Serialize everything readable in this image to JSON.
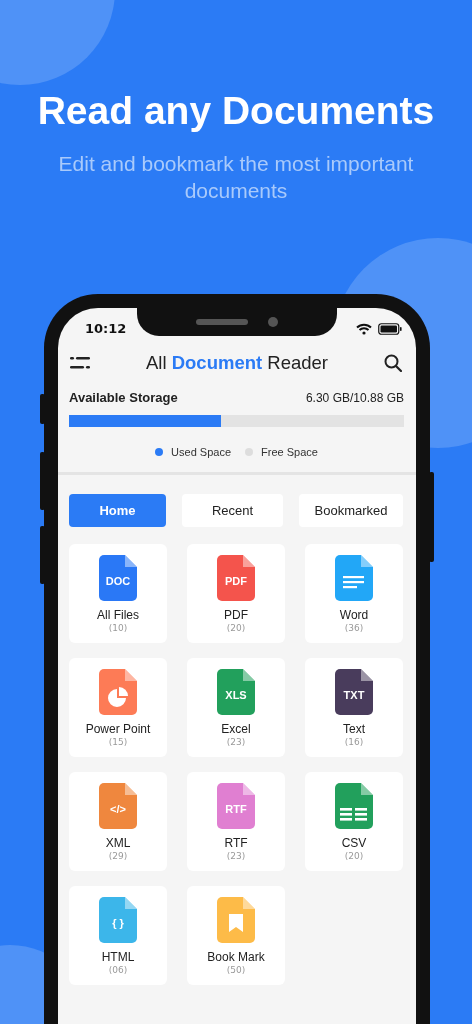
{
  "headline": "Read any Documents",
  "subheadline": "Edit and bookmark the most important documents",
  "status_bar": {
    "time": "10:12"
  },
  "app_bar": {
    "title": "All **Document** Reader"
  },
  "storage": {
    "label": "Available Storage",
    "reading": "6.30 GB/10.88 GB",
    "level": 0.454,
    "legend": [
      {
        "label": "Used Space",
        "color": "#2b7bf5"
      },
      {
        "label": "Free Space",
        "color": "#dddddd"
      }
    ]
  },
  "tabs": [
    {
      "label": "Home",
      "selected": true
    },
    {
      "label": "Recent",
      "selected": false
    },
    {
      "label": "Bookmarked",
      "selected": false
    }
  ],
  "categories": [
    {
      "name": "All Files",
      "count": "(10)",
      "color": "#2a78f6",
      "kind": "label",
      "icon_text": "DOC"
    },
    {
      "name": "PDF",
      "count": "(20)",
      "color": "#f4544c",
      "kind": "label",
      "icon_text": "PDF"
    },
    {
      "name": "Word",
      "count": "(36)",
      "color": "#22a7f7",
      "kind": "lines"
    },
    {
      "name": "Power Point",
      "count": "(15)",
      "color": "#fd7b56",
      "kind": "pie"
    },
    {
      "name": "Excel",
      "count": "(23)",
      "color": "#22a05c",
      "kind": "label",
      "icon_text": "XLS"
    },
    {
      "name": "Text",
      "count": "(16)",
      "color": "#493c5c",
      "kind": "label",
      "icon_text": "TXT"
    },
    {
      "name": "XML",
      "count": "(29)",
      "color": "#ef873e",
      "kind": "label",
      "icon_text": "</>"
    },
    {
      "name": "RTF",
      "count": "(23)",
      "color": "#e07fd1",
      "kind": "label",
      "icon_text": "RTF"
    },
    {
      "name": "CSV",
      "count": "(20)",
      "color": "#22a05c",
      "kind": "grid"
    },
    {
      "name": "HTML",
      "count": "(06)",
      "color": "#3cb6ea",
      "kind": "label",
      "icon_text": "{ }"
    },
    {
      "name": "Book Mark",
      "count": "(50)",
      "color": "#fdbb48",
      "kind": "bookmark"
    }
  ]
}
